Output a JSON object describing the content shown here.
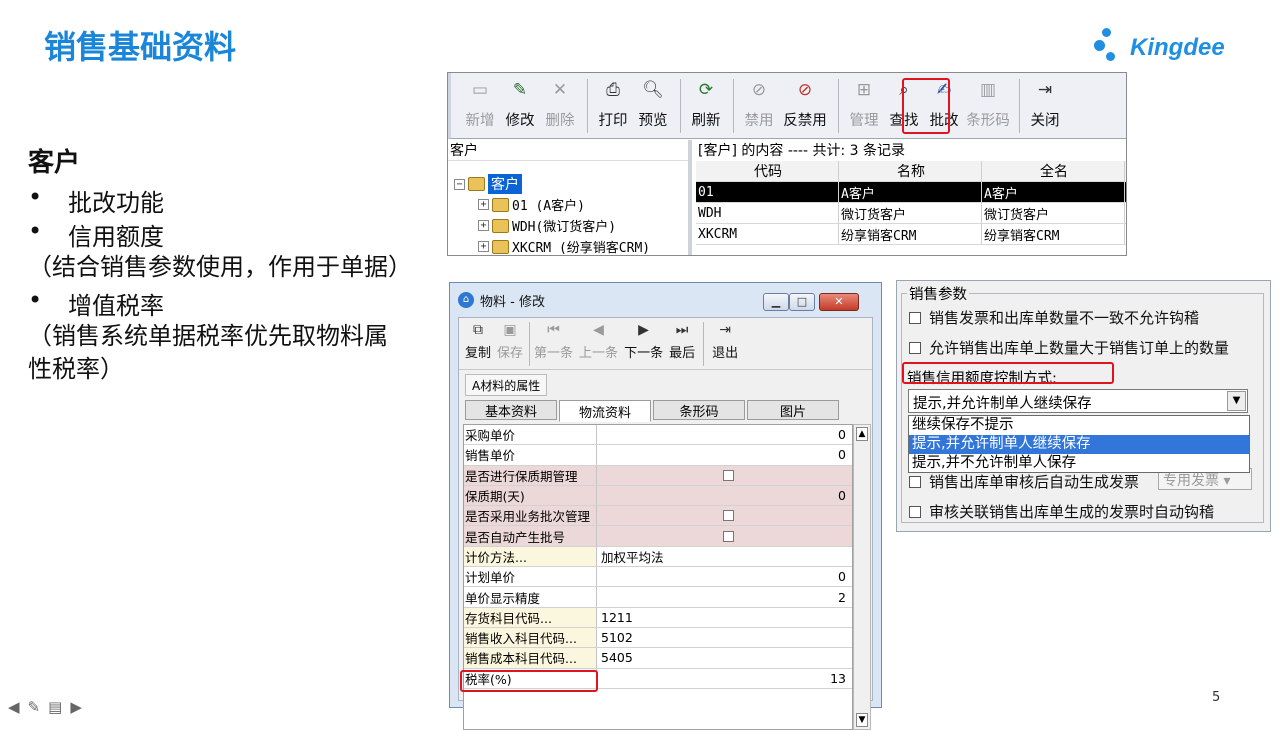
{
  "slide": {
    "title": "销售基础资料",
    "logo_text": "Kingdee",
    "page_number": "5",
    "colors": {
      "title": "#1a86d9",
      "highlight_box": "#e0141e",
      "selection": "#0a64d6"
    }
  },
  "left_text": {
    "heading": "客户",
    "bullet1": "批改功能",
    "bullet2": "信用额度",
    "note2": "（结合销售参数使用，作用于单据）",
    "bullet3": "增值税率",
    "note3": "（销售系统单据税率优先取物料属性税率）"
  },
  "customer_window": {
    "toolbar": {
      "new": "新增",
      "edit": "修改",
      "delete": "删除",
      "print": "打印",
      "preview": "预览",
      "refresh": "刷新",
      "disable": "禁用",
      "enable": "反禁用",
      "manage": "管理",
      "find": "查找",
      "batch_edit": "批改",
      "barcode": "条形码",
      "close": "关闭"
    },
    "tree": {
      "header": "客户",
      "root": "客户",
      "nodes": [
        "01 (A客户)",
        "WDH(微订货客户)",
        "XKCRM (纷享销客CRM)"
      ]
    },
    "grid": {
      "header": "[客户] 的内容 ---- 共计: 3 条记录",
      "columns": [
        "代码",
        "名称",
        "全名"
      ],
      "rows": [
        [
          "01",
          "A客户",
          "A客户"
        ],
        [
          "WDH",
          "微订货客户",
          "微订货客户"
        ],
        [
          "XKCRM",
          "纷享销客CRM",
          "纷享销客CRM"
        ]
      ]
    }
  },
  "material_window": {
    "title": "物料 - 修改",
    "toolbar": {
      "copy": "复制",
      "save": "保存",
      "first": "第一条",
      "prev": "上一条",
      "next": "下一条",
      "last": "最后",
      "exit": "退出"
    },
    "group_label": "A材料的属性",
    "tabs": [
      "基本资料",
      "物流资料",
      "条形码",
      "图片"
    ],
    "props": [
      {
        "label": "采购单价",
        "value": "0"
      },
      {
        "label": "销售单价",
        "value": "0"
      },
      {
        "label": "是否进行保质期管理",
        "value": ""
      },
      {
        "label": "保质期(天)",
        "value": "0"
      },
      {
        "label": "是否采用业务批次管理",
        "value": ""
      },
      {
        "label": "是否自动产生批号",
        "value": ""
      },
      {
        "label": "计价方法...",
        "value": "加权平均法"
      },
      {
        "label": "计划单价",
        "value": "0"
      },
      {
        "label": "单价显示精度",
        "value": "2"
      },
      {
        "label": "存货科目代码...",
        "value": "1211"
      },
      {
        "label": "销售收入科目代码...",
        "value": "5102"
      },
      {
        "label": "销售成本科目代码...",
        "value": "5405"
      },
      {
        "label": "税率(%)",
        "value": "13"
      }
    ]
  },
  "sales_params": {
    "legend": "销售参数",
    "opt1": "销售发票和出库单数量不一致不允许钩稽",
    "opt2": "允许销售出库单上数量大于销售订单上的数量",
    "credit_label": "销售信用额度控制方式:",
    "credit_value": "提示,并允许制单人继续保存",
    "dropdown_options": [
      "继续保存不提示",
      "提示,并允许制单人继续保存",
      "提示,并不允许制单人保存"
    ],
    "opt3": "销售出库单审核后自动生成发票",
    "opt3_combo": "专用发票",
    "opt4": "审核关联销售出库单生成的发票时自动钩稽"
  }
}
